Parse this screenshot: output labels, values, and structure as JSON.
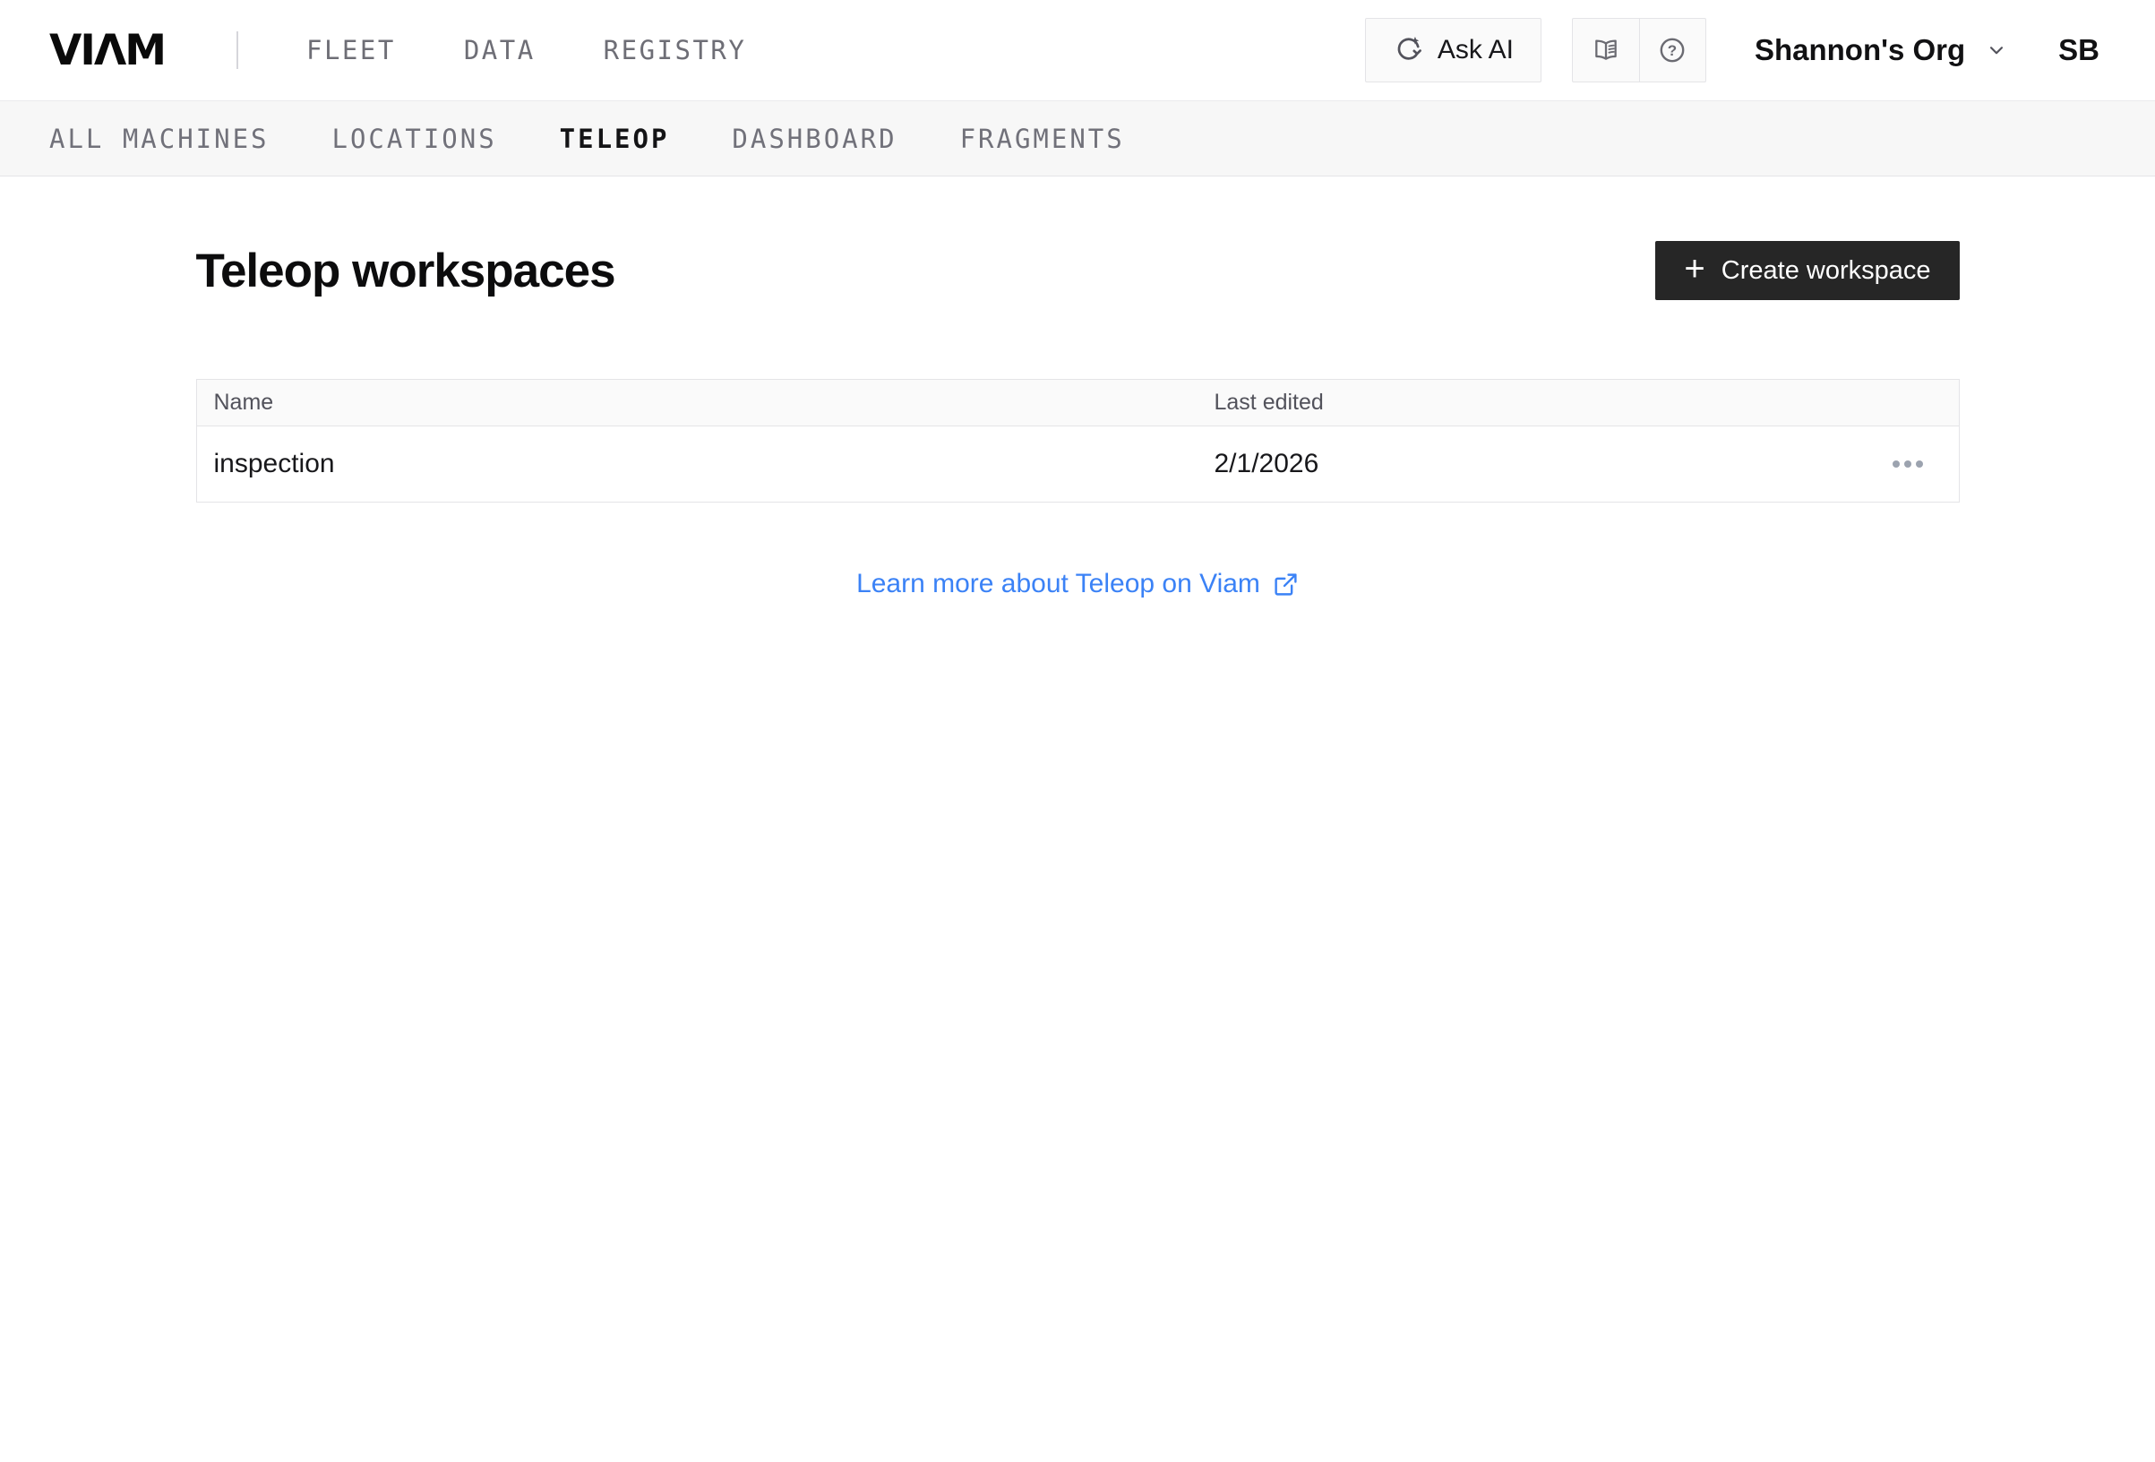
{
  "topbar": {
    "logo": "VIΛM",
    "nav": [
      {
        "label": "FLEET"
      },
      {
        "label": "DATA"
      },
      {
        "label": "REGISTRY"
      }
    ],
    "ask_ai": {
      "label": "Ask AI",
      "icon": "ask-ai-sparkle-icon"
    },
    "utility": [
      {
        "icon": "docs-book-icon"
      },
      {
        "icon": "help-question-icon"
      }
    ],
    "org": {
      "label": "Shannon's Org",
      "icon": "chevron-down-icon"
    },
    "avatar": {
      "initials": "SB"
    }
  },
  "tabbar": {
    "tabs": [
      {
        "label": "ALL MACHINES",
        "active": false
      },
      {
        "label": "LOCATIONS",
        "active": false
      },
      {
        "label": "TELEOP",
        "active": true
      },
      {
        "label": "DASHBOARD",
        "active": false
      },
      {
        "label": "FRAGMENTS",
        "active": false
      }
    ]
  },
  "main": {
    "title": "Teleop workspaces",
    "create_button": {
      "plus": "+",
      "label": "Create workspace"
    },
    "table": {
      "columns": [
        "Name",
        "Last edited"
      ],
      "rows": [
        {
          "name": "inspection",
          "last_edited": "2/1/2026",
          "menu_icon": "ellipsis-menu-icon"
        }
      ]
    },
    "learn_more": {
      "label": "Learn more about Teleop on Viam",
      "icon": "external-link-icon"
    }
  },
  "icons": {
    "help_glyph": "?"
  },
  "colors": {
    "link_blue": "#3b82f6",
    "button_dark": "#262626",
    "tabbar_bg": "#f7f7f7",
    "border": "#e4e4e7",
    "muted_text": "#71717a"
  }
}
